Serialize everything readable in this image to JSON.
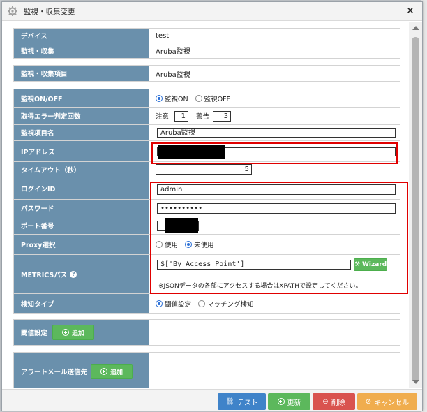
{
  "dialog": {
    "title": "監視・収集変更",
    "close": "×"
  },
  "info": [
    {
      "label": "デバイス",
      "value": "test"
    },
    {
      "label": "監視・収集",
      "value": "Aruba監視"
    }
  ],
  "item": {
    "label": "監視・収集項目",
    "value": "Aruba監視"
  },
  "form": {
    "monitor_onoff": {
      "label": "監視ON/OFF",
      "on": "監視ON",
      "off": "監視OFF"
    },
    "error_count": {
      "label": "取得エラー判定回数",
      "caution_label": "注意",
      "caution_value": "1",
      "warning_label": "警告",
      "warning_value": "3"
    },
    "item_name": {
      "label": "監視項目名",
      "value": "Aruba監視"
    },
    "ip": {
      "label": "IPアドレス"
    },
    "timeout": {
      "label": "タイムアウト（秒）",
      "value": "5"
    },
    "login_id": {
      "label": "ログインID",
      "value": "admin"
    },
    "password": {
      "label": "パスワード",
      "value": "••••••••••"
    },
    "port": {
      "label": "ポート番号"
    },
    "proxy": {
      "label": "Proxy選択",
      "use": "使用",
      "not_use": "未使用"
    },
    "metrics": {
      "label": "METRICSパス",
      "info_icon": "?",
      "value": "$['By Access Point']",
      "wizard": "Wizard",
      "note": "※JSONデータの各部にアクセスする場合はXPATHで設定してください。"
    },
    "detect_type": {
      "label": "検知タイプ",
      "threshold": "閾値設定",
      "matching": "マッチング検知"
    }
  },
  "threshold": {
    "label": "閾値設定",
    "add": "追加"
  },
  "alert_mail": {
    "label": "アラートメール送信先",
    "add": "追加"
  },
  "footer": {
    "test": "テスト",
    "update": "更新",
    "delete": "削除",
    "cancel": "キャンセル"
  },
  "colors": {
    "label_bg": "#6a90ac",
    "test": "#3f83c9",
    "update": "#5cb85c",
    "delete": "#d9534f",
    "cancel": "#f0ad4e",
    "highlight": "#e00000"
  }
}
